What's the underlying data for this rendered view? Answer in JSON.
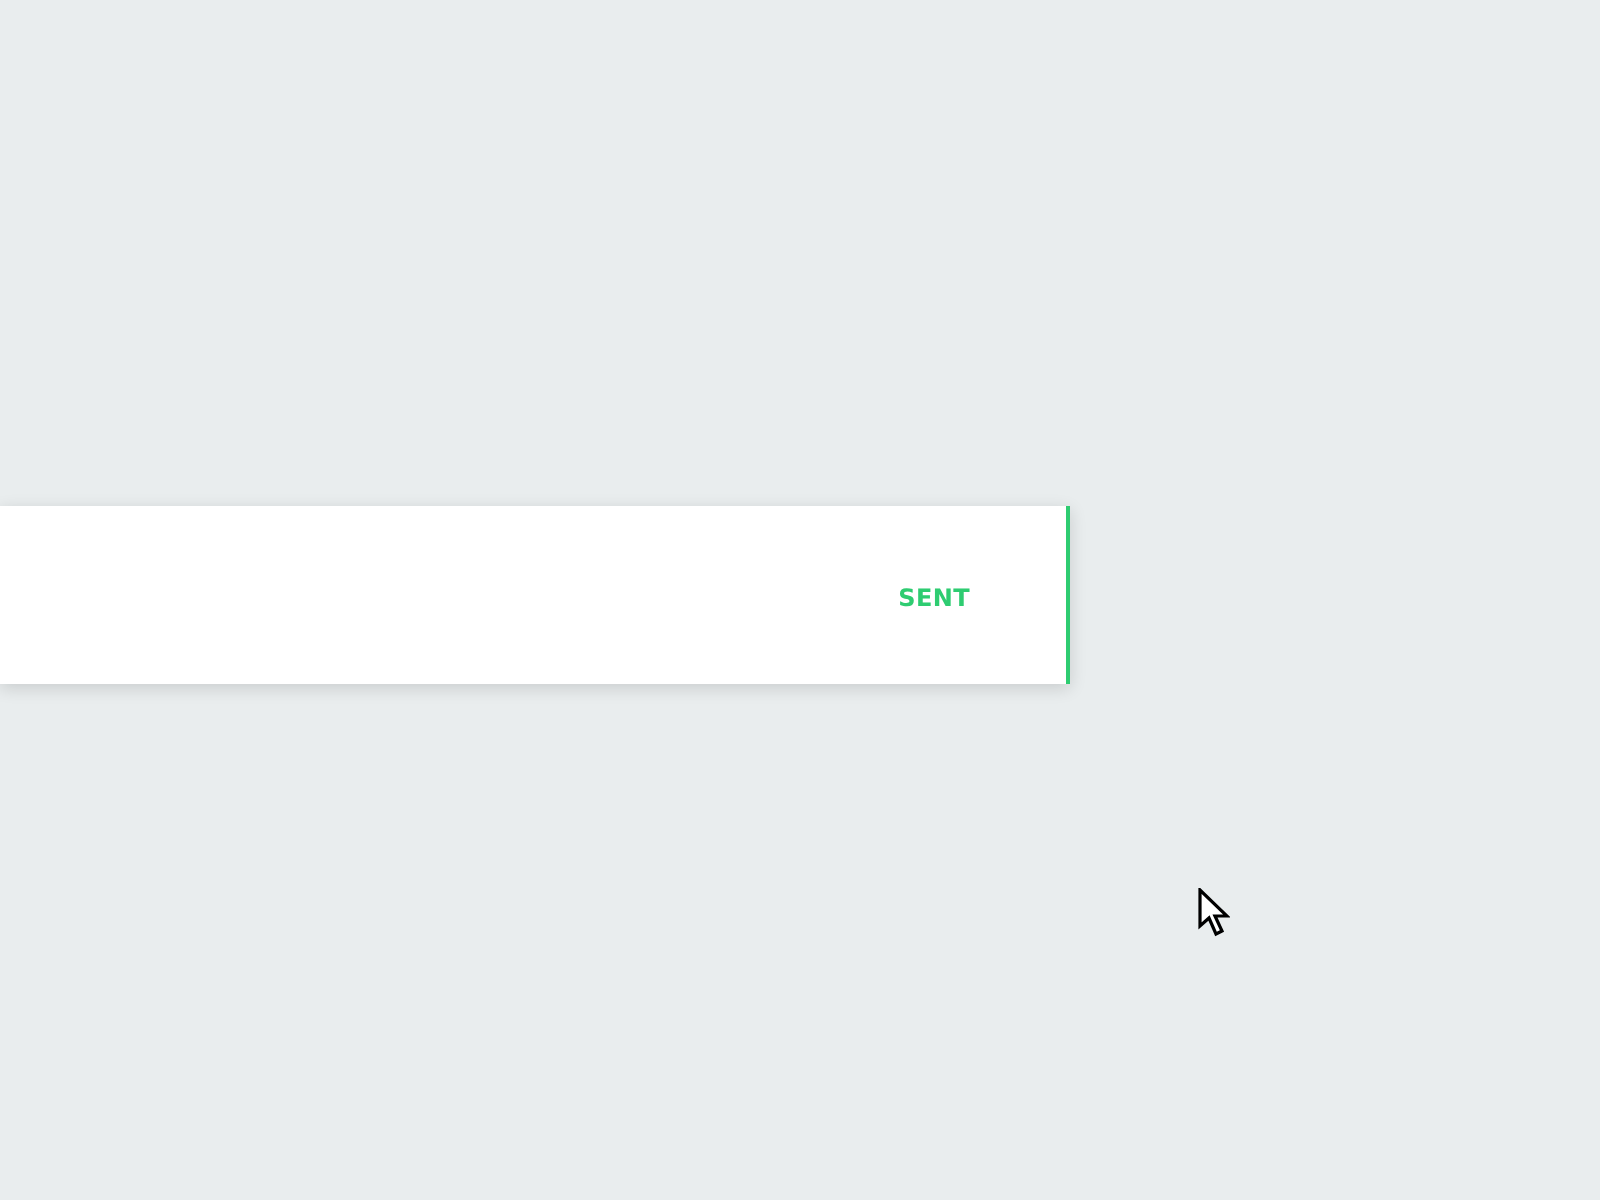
{
  "message_card": {
    "status": "SENT"
  }
}
